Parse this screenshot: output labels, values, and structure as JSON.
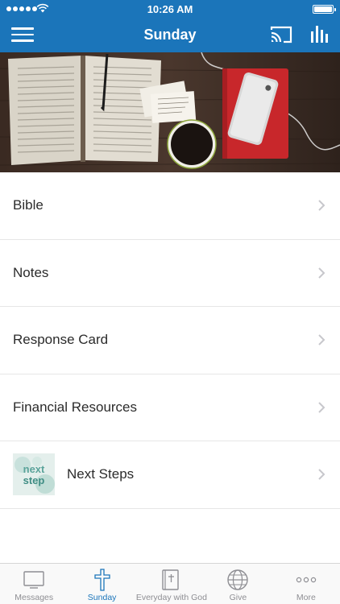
{
  "status_bar": {
    "time": "10:26 AM",
    "battery_level": 1.0
  },
  "nav": {
    "title": "Sunday"
  },
  "list": {
    "items": [
      {
        "label": "Bible"
      },
      {
        "label": "Notes"
      },
      {
        "label": "Response Card"
      },
      {
        "label": "Financial Resources"
      },
      {
        "label": "Next Steps",
        "thumbnail_text": "next step"
      }
    ]
  },
  "tabs": [
    {
      "label": "Messages",
      "icon": "tv-icon"
    },
    {
      "label": "Sunday",
      "icon": "cross-icon",
      "active": true
    },
    {
      "label": "Everyday with God",
      "icon": "book-icon"
    },
    {
      "label": "Give",
      "icon": "globe-icon"
    },
    {
      "label": "More",
      "icon": "more-dots-icon"
    }
  ],
  "colors": {
    "accent": "#1b75ba",
    "tab_inactive": "#8e8e93",
    "divider": "#e6e6e6"
  }
}
